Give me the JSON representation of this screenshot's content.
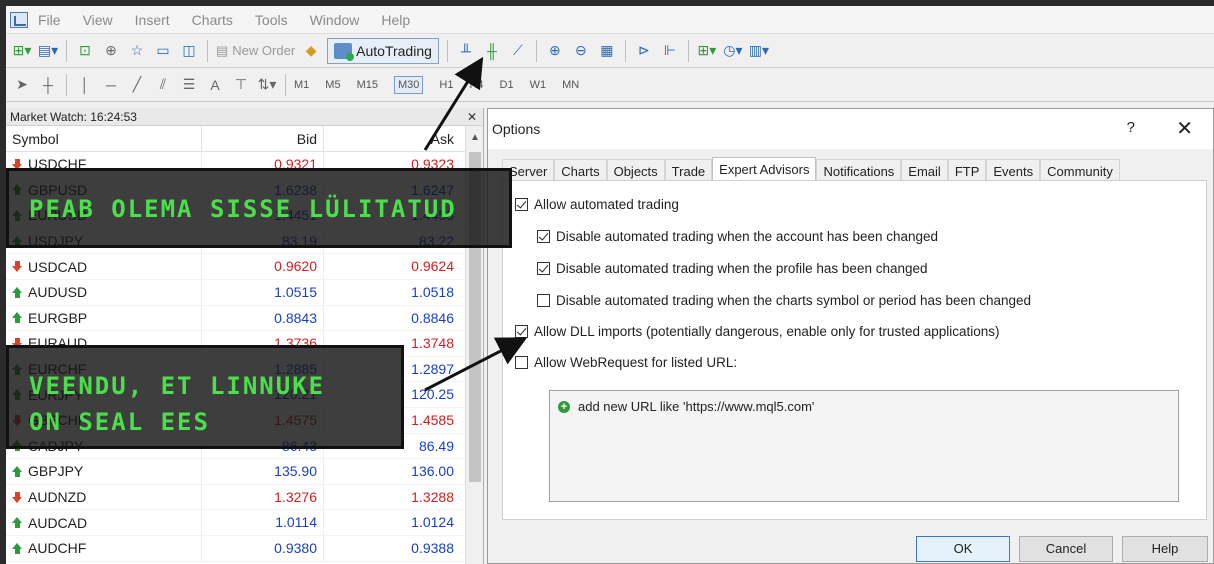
{
  "menu": [
    "File",
    "View",
    "Insert",
    "Charts",
    "Tools",
    "Window",
    "Help"
  ],
  "toolbar": {
    "new_order_label": "New Order",
    "autotrading_label": "AutoTrading"
  },
  "timeframes": [
    "M1",
    "M5",
    "M15",
    "M30",
    "H1",
    "H4",
    "D1",
    "W1",
    "MN"
  ],
  "market_watch": {
    "title": "Market Watch: 16:24:53",
    "columns": {
      "symbol": "Symbol",
      "bid": "Bid",
      "ask": "Ask"
    },
    "rows": [
      {
        "symbol": "USDCHF",
        "bid": "0.9321",
        "ask": "0.9323",
        "dir": "down"
      },
      {
        "symbol": "GBPUSD",
        "bid": "1.6238",
        "ask": "1.6247",
        "dir": "up"
      },
      {
        "symbol": "EURUSD",
        "bid": "1.4451",
        "ask": "1.4453",
        "dir": "up"
      },
      {
        "symbol": "USDJPY",
        "bid": "83.19",
        "ask": "83.22",
        "dir": "up"
      },
      {
        "symbol": "USDCAD",
        "bid": "0.9620",
        "ask": "0.9624",
        "dir": "down"
      },
      {
        "symbol": "AUDUSD",
        "bid": "1.0515",
        "ask": "1.0518",
        "dir": "up"
      },
      {
        "symbol": "EURGBP",
        "bid": "0.8843",
        "ask": "0.8846",
        "dir": "up"
      },
      {
        "symbol": "EURAUD",
        "bid": "1.3736",
        "ask": "1.3748",
        "dir": "down"
      },
      {
        "symbol": "EURCHF",
        "bid": "1.2885",
        "ask": "1.2897",
        "dir": "up"
      },
      {
        "symbol": "EURJPY",
        "bid": "120.21",
        "ask": "120.25",
        "dir": "up"
      },
      {
        "symbol": "GBPCHF",
        "bid": "1.4575",
        "ask": "1.4585",
        "dir": "down"
      },
      {
        "symbol": "CADJPY",
        "bid": "86.43",
        "ask": "86.49",
        "dir": "up"
      },
      {
        "symbol": "GBPJPY",
        "bid": "135.90",
        "ask": "136.00",
        "dir": "up"
      },
      {
        "symbol": "AUDNZD",
        "bid": "1.3276",
        "ask": "1.3288",
        "dir": "down"
      },
      {
        "symbol": "AUDCAD",
        "bid": "1.0114",
        "ask": "1.0124",
        "dir": "up"
      },
      {
        "symbol": "AUDCHF",
        "bid": "0.9380",
        "ask": "0.9388",
        "dir": "up"
      }
    ]
  },
  "dialog": {
    "title": "Options",
    "help_glyph": "?",
    "close_glyph": "✕",
    "tabs": [
      "Server",
      "Charts",
      "Objects",
      "Trade",
      "Expert Advisors",
      "Notifications",
      "Email",
      "FTP",
      "Events",
      "Community"
    ],
    "active_tab": "Expert Advisors",
    "options": [
      {
        "label": "Allow automated trading",
        "checked": true
      },
      {
        "label": "Disable automated trading when the account has been changed",
        "checked": true
      },
      {
        "label": "Disable automated trading when the profile has been changed",
        "checked": true
      },
      {
        "label": "Disable automated trading when the charts symbol or period has been changed",
        "checked": false
      },
      {
        "label": "Allow DLL imports (potentially dangerous, enable only for trusted applications)",
        "checked": true
      },
      {
        "label": "Allow WebRequest for listed URL:",
        "checked": false
      }
    ],
    "url_placeholder": "add new URL like 'https://www.mql5.com'",
    "buttons": {
      "ok": "OK",
      "cancel": "Cancel",
      "help": "Help"
    }
  },
  "overlays": {
    "banner1": "PEAB OLEMA SISSE LÜLITATUD",
    "banner2_line1": "VEENDU, ET LINNUKE",
    "banner2_line2": "ON SEAL EES",
    "color": "#4be04b"
  }
}
